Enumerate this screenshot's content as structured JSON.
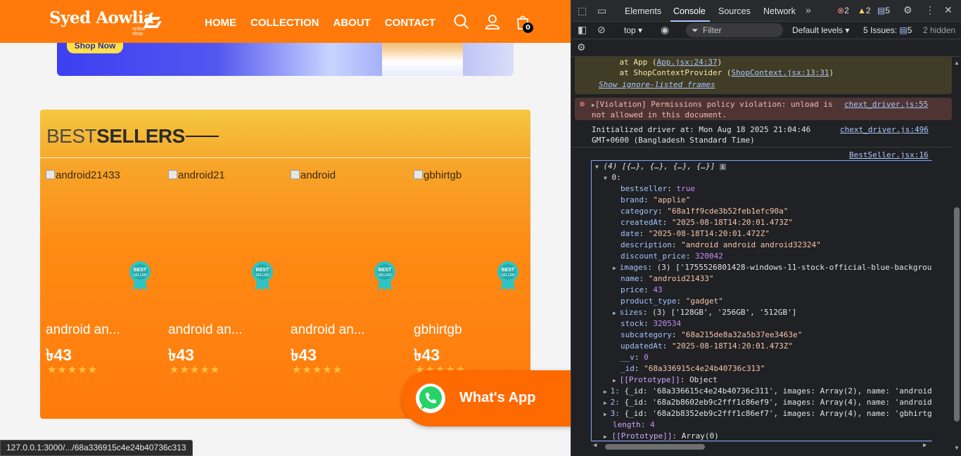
{
  "site": {
    "logo": {
      "name": "Syed Aowlia",
      "tagline": "online shop"
    },
    "nav": [
      "HOME",
      "COLLECTION",
      "ABOUT",
      "CONTACT"
    ],
    "cart_count": "0",
    "banner": {
      "button": "Shop Now"
    },
    "bestseller": {
      "title_light": "BEST",
      "title_bold": "SELLERS",
      "products": [
        {
          "alt": "android21433",
          "name": "android an...",
          "price": "৳43",
          "rating": 5,
          "badge": "BEST SELLER"
        },
        {
          "alt": "android21",
          "name": "android an...",
          "price": "৳43",
          "rating": 5,
          "badge": "BEST SELLER"
        },
        {
          "alt": "android",
          "name": "android an...",
          "price": "৳43",
          "rating": 5,
          "badge": "BEST SELLER"
        },
        {
          "alt": "gbhirtgb",
          "name": "gbhirtgb",
          "price": "৳43",
          "rating": 5,
          "badge": "BEST SELLER"
        }
      ]
    },
    "whatsapp": "What's App",
    "status_url": "127.0.0.1:3000/.../68a336915c4e24b40736c313"
  },
  "devtools": {
    "tabs": [
      "Elements",
      "Console",
      "Sources",
      "Network"
    ],
    "active_tab": "Console",
    "counts": {
      "errors": "2",
      "warnings": "2",
      "messages": "5"
    },
    "context": "top",
    "filter_placeholder": "Filter",
    "levels": "Default levels",
    "issues": "5 Issues:",
    "issues_count": "5",
    "hidden": "2 hidden",
    "warn": {
      "l1_pre": "    at App (",
      "l1_link": "App.jsx:24:37",
      "l1_post": ")",
      "l2_pre": "    at ShopContextProvider (",
      "l2_link": "ShopContext.jsx:13:31",
      "l2_post": ")",
      "l3": "Show ignore-listed frames"
    },
    "error": {
      "text1": "[Violation] Permissions policy violation: unload is",
      "text2": "not allowed in this document.",
      "source": "chext_driver.js:55"
    },
    "info": {
      "text1": "Initialized driver at: Mon Aug 18 2025 21:04:46",
      "text2": "GMT+0600 (Bangladesh Standard Time)",
      "source": "chext_driver.js:496"
    },
    "log_source": "BestSeller.jsx:16",
    "object": {
      "header": "(4) [{…}, {…}, {…}, {…}]",
      "index0": "0:",
      "fields": [
        {
          "k": "bestseller",
          "v": "true",
          "t": "b"
        },
        {
          "k": "brand",
          "v": "\"applie\"",
          "t": "s"
        },
        {
          "k": "category",
          "v": "\"68a1ff9cde3b52feb1efc90a\"",
          "t": "s"
        },
        {
          "k": "createdAt",
          "v": "\"2025-08-18T14:20:01.473Z\"",
          "t": "s"
        },
        {
          "k": "date",
          "v": "\"2025-08-18T14:20:01.472Z\"",
          "t": "s"
        },
        {
          "k": "description",
          "v": "\"android android android32324\"",
          "t": "s"
        },
        {
          "k": "discount_price",
          "v": "320042",
          "t": "n"
        },
        {
          "k": "images",
          "v": "(3) ['1755526801428-windows-11-stock-official-blue-backgrou",
          "t": "x",
          "exp": true
        },
        {
          "k": "name",
          "v": "\"android21433\"",
          "t": "s"
        },
        {
          "k": "price",
          "v": "43",
          "t": "n"
        },
        {
          "k": "product_type",
          "v": "\"gadget\"",
          "t": "s"
        },
        {
          "k": "sizes",
          "v": "(3) ['128GB', '256GB', '512GB']",
          "t": "x",
          "exp": true
        },
        {
          "k": "stock",
          "v": "320534",
          "t": "n"
        },
        {
          "k": "subcategory",
          "v": "\"68a215de8a32a5b37ee3463e\"",
          "t": "s"
        },
        {
          "k": "updatedAt",
          "v": "\"2025-08-18T14:20:01.473Z\"",
          "t": "s"
        },
        {
          "k": "__v",
          "v": "0",
          "t": "n"
        },
        {
          "k": "_id",
          "v": "\"68a336915c4e24b40736c313\"",
          "t": "s"
        },
        {
          "k": "[[Prototype]]",
          "v": "Object",
          "t": "p",
          "exp": true
        }
      ],
      "rows": [
        {
          "idx": "1:",
          "body": "{_id: '68a336615c4e24b40736c311', images: Array(2), name: 'android"
        },
        {
          "idx": "2:",
          "body": "{_id: '68a2b8602eb9c2fff1c86ef9', images: Array(4), name: 'android"
        },
        {
          "idx": "3:",
          "body": "{_id: '68a2b8352eb9c2fff1c86ef7', images: Array(4), name: 'gbhirtg"
        }
      ],
      "length_label": "length:",
      "length": "4",
      "proto": "[[Prototype]]:",
      "proto_val": "Array(0)"
    }
  },
  "colors": {
    "header_orange": "#ff7a0a",
    "devtools_bg": "#202124",
    "link_blue": "#a8c7fa"
  }
}
